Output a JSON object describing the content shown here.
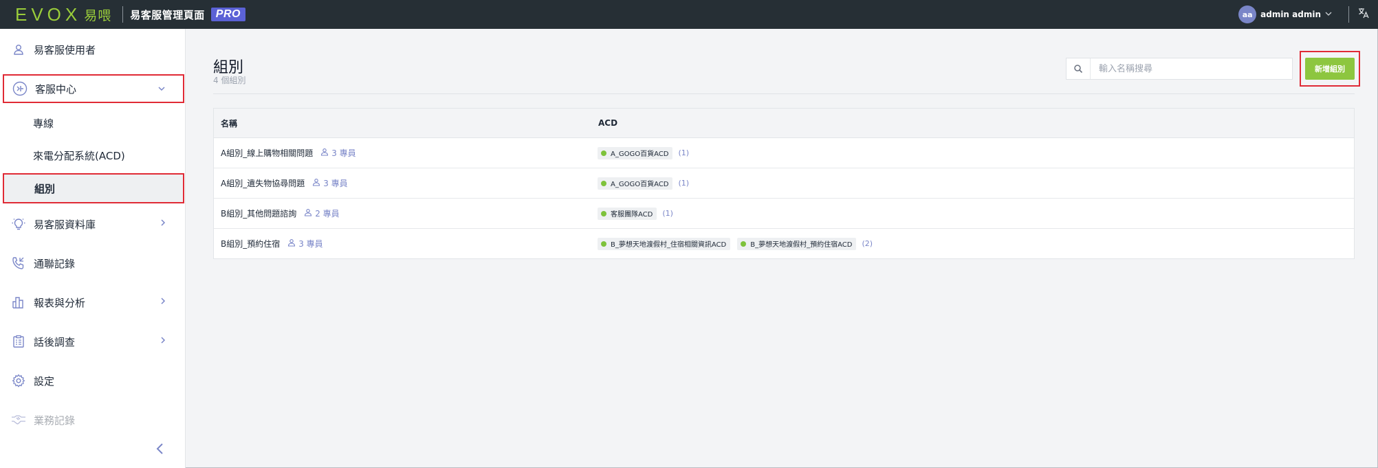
{
  "header": {
    "logo_evox": "EVOX",
    "logo_cn": "易喂",
    "app_title": "易客服管理頁面",
    "badge": "PRO",
    "avatar_initials": "aa",
    "user_name": "admin admin"
  },
  "sidebar": {
    "items": [
      {
        "label": "易客服使用者",
        "icon": "user-icon"
      },
      {
        "label": "客服中心",
        "icon": "headset-icon"
      },
      {
        "label": "專線"
      },
      {
        "label": "來電分配系統(ACD)"
      },
      {
        "label": "組別"
      },
      {
        "label": "易客服資料庫",
        "icon": "lightbulb-icon"
      },
      {
        "label": "通聯記錄",
        "icon": "phone-log-icon"
      },
      {
        "label": "報表與分析",
        "icon": "bar-chart-icon"
      },
      {
        "label": "話後調查",
        "icon": "survey-icon"
      },
      {
        "label": "設定",
        "icon": "gear-icon"
      },
      {
        "label": "業務記錄",
        "icon": "handshake-icon"
      }
    ]
  },
  "main": {
    "title": "組別",
    "count_text": "4 個組別",
    "search_placeholder": "輸入名稱搜尋",
    "add_button": "新增組別",
    "table": {
      "headers": [
        "名稱",
        "ACD"
      ],
      "rows": [
        {
          "name": "A組別_線上購物相關問題",
          "members": "3 專員",
          "acds": [
            "A_GOGO百貨ACD"
          ],
          "acd_count": "(1)"
        },
        {
          "name": "A組別_遺失物協尋問題",
          "members": "3 專員",
          "acds": [
            "A_GOGO百貨ACD"
          ],
          "acd_count": "(1)"
        },
        {
          "name": "B組別_其他問題諮詢",
          "members": "2 專員",
          "acds": [
            "客服團隊ACD"
          ],
          "acd_count": "(1)"
        },
        {
          "name": "B組別_預約住宿",
          "members": "3 專員",
          "acds": [
            "B_夢想天地渡假村_住宿相關資訊ACD",
            "B_夢想天地渡假村_預約住宿ACD"
          ],
          "acd_count": "(2)"
        }
      ]
    }
  },
  "colors": {
    "topbar": "#262f35",
    "brand_green": "#9acd3a",
    "accent_button": "#8dc63f",
    "pro_badge": "#5b62d6",
    "highlight_red": "#e02a35",
    "icon_blue": "#7a86c8",
    "status_dot": "#7ec23b"
  }
}
